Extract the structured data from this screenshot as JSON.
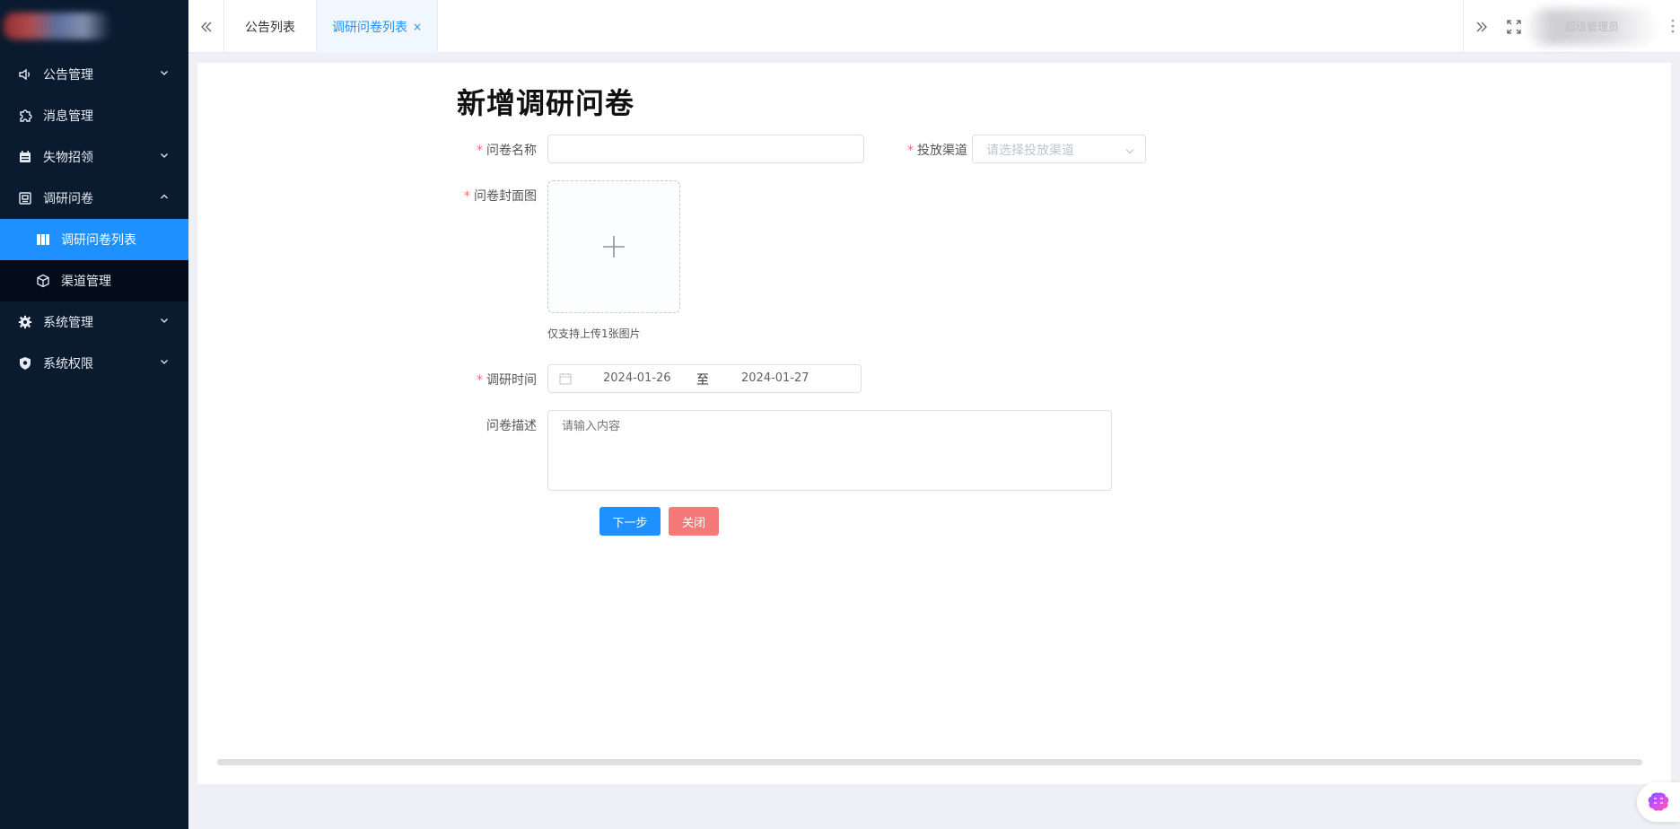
{
  "sidebar": {
    "items": [
      {
        "label": "公告管理",
        "icon": "speaker-icon",
        "expandable": true,
        "expanded": false
      },
      {
        "label": "消息管理",
        "icon": "puzzle-icon",
        "expandable": false
      },
      {
        "label": "失物招领",
        "icon": "calendar-icon",
        "expandable": true,
        "expanded": false
      },
      {
        "label": "调研问卷",
        "icon": "survey-icon",
        "expandable": true,
        "expanded": true,
        "children": [
          {
            "label": "调研问卷列表",
            "icon": "grid-columns-icon",
            "active": true
          },
          {
            "label": "渠道管理",
            "icon": "cube-icon",
            "active": false
          }
        ]
      },
      {
        "label": "系统管理",
        "icon": "gear-icon",
        "expandable": true,
        "expanded": false
      },
      {
        "label": "系统权限",
        "icon": "shield-icon",
        "expandable": true,
        "expanded": false
      }
    ]
  },
  "tabs": [
    {
      "label": "公告列表",
      "active": false
    },
    {
      "label": "调研问卷列表",
      "active": true,
      "close": "×"
    }
  ],
  "header": {
    "username": "超级管理员"
  },
  "form": {
    "title": "新增调研问卷",
    "required_mark": "*",
    "name_label": "问卷名称",
    "name_value": "",
    "channel_label": "投放渠道",
    "channel_placeholder": "请选择投放渠道",
    "cover_label": "问卷封面图",
    "cover_tip": "仅支持上传1张图片",
    "time_label": "调研时间",
    "date_start": "2024-01-26",
    "date_separator": "至",
    "date_end": "2024-01-27",
    "desc_label": "问卷描述",
    "desc_placeholder": "请输入内容",
    "next_button": "下一步",
    "close_button": "关闭"
  },
  "colors": {
    "sidebar_bg": "#0a1a2f",
    "active_blue": "#1e90ff",
    "danger": "#f47a7a",
    "required": "#f56c6c"
  }
}
